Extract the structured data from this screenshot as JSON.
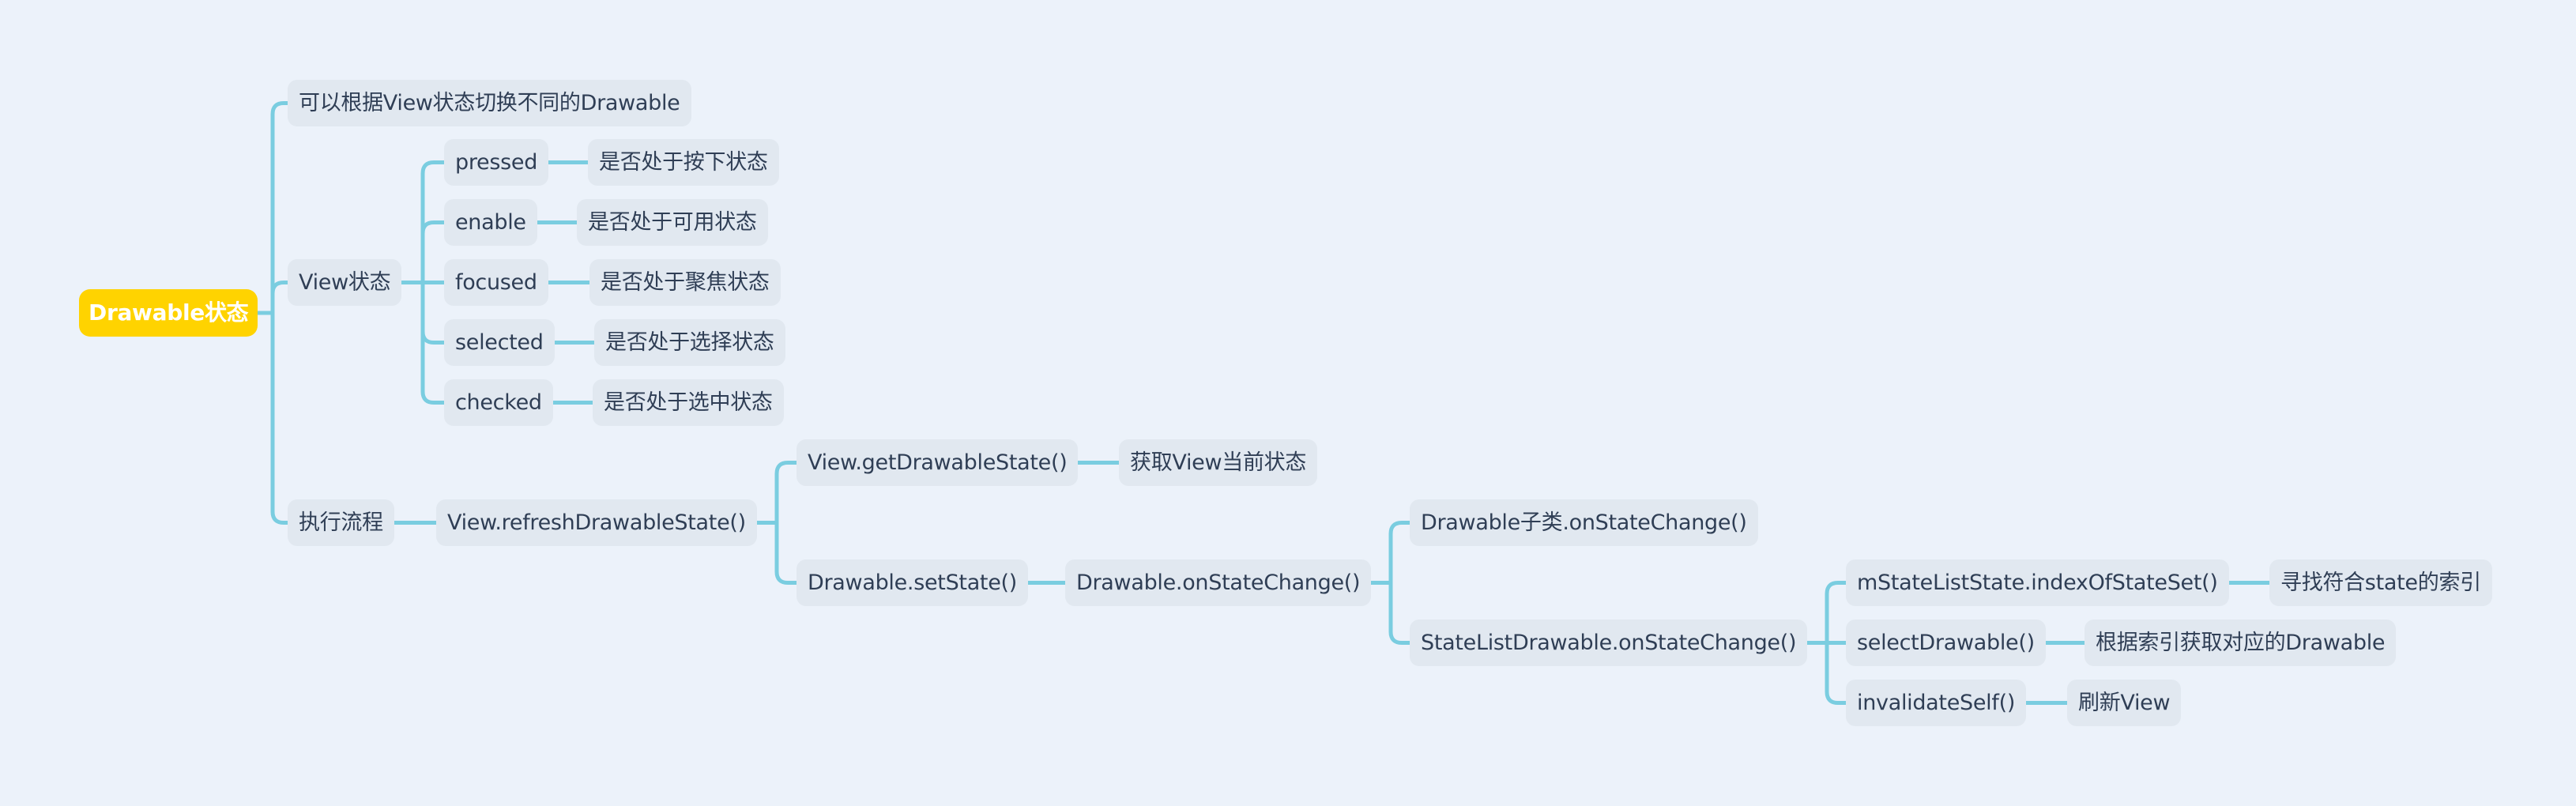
{
  "colors": {
    "background": "#ECF2FA",
    "root_fill": "#FFD300",
    "root_text": "#FFFFFF",
    "node_fill": "#E1E8F0",
    "node_text": "#2F3E55",
    "connector": "#7ACDE0"
  },
  "mindmap": {
    "root": {
      "id": "root",
      "label": "Drawable状态"
    },
    "nodes": [
      {
        "id": "n_desc",
        "parent": "root",
        "label": "可以根据View状态切换不同的Drawable"
      },
      {
        "id": "n_view_state",
        "parent": "root",
        "label": "View状态"
      },
      {
        "id": "n_pressed",
        "parent": "n_view_state",
        "label": "pressed"
      },
      {
        "id": "n_pressed_desc",
        "parent": "n_pressed",
        "label": "是否处于按下状态"
      },
      {
        "id": "n_enable",
        "parent": "n_view_state",
        "label": "enable"
      },
      {
        "id": "n_enable_desc",
        "parent": "n_enable",
        "label": "是否处于可用状态"
      },
      {
        "id": "n_focused",
        "parent": "n_view_state",
        "label": "focused"
      },
      {
        "id": "n_focused_desc",
        "parent": "n_focused",
        "label": "是否处于聚焦状态"
      },
      {
        "id": "n_selected",
        "parent": "n_view_state",
        "label": "selected"
      },
      {
        "id": "n_selected_desc",
        "parent": "n_selected",
        "label": "是否处于选择状态"
      },
      {
        "id": "n_checked",
        "parent": "n_view_state",
        "label": "checked"
      },
      {
        "id": "n_checked_desc",
        "parent": "n_checked",
        "label": "是否处于选中状态"
      },
      {
        "id": "n_flow",
        "parent": "root",
        "label": "执行流程"
      },
      {
        "id": "n_refresh",
        "parent": "n_flow",
        "label": "View.refreshDrawableState()"
      },
      {
        "id": "n_get_state",
        "parent": "n_refresh",
        "label": "View.getDrawableState()"
      },
      {
        "id": "n_get_state_desc",
        "parent": "n_get_state",
        "label": "获取View当前状态"
      },
      {
        "id": "n_set_state",
        "parent": "n_refresh",
        "label": "Drawable.setState()"
      },
      {
        "id": "n_on_change",
        "parent": "n_set_state",
        "label": "Drawable.onStateChange()"
      },
      {
        "id": "n_subclass_change",
        "parent": "n_on_change",
        "label": "Drawable子类.onStateChange()"
      },
      {
        "id": "n_statelist_change",
        "parent": "n_on_change",
        "label": "StateListDrawable.onStateChange()"
      },
      {
        "id": "n_index_of",
        "parent": "n_statelist_change",
        "label": "mStateListState.indexOfStateSet()"
      },
      {
        "id": "n_index_of_desc",
        "parent": "n_index_of",
        "label": "寻找符合state的索引"
      },
      {
        "id": "n_select_drawable",
        "parent": "n_statelist_change",
        "label": "selectDrawable()"
      },
      {
        "id": "n_select_drawable_desc",
        "parent": "n_select_drawable",
        "label": "根据索引获取对应的Drawable"
      },
      {
        "id": "n_invalidate",
        "parent": "n_statelist_change",
        "label": "invalidateSelf()"
      },
      {
        "id": "n_invalidate_desc",
        "parent": "n_invalidate",
        "label": "刷新View"
      }
    ]
  }
}
